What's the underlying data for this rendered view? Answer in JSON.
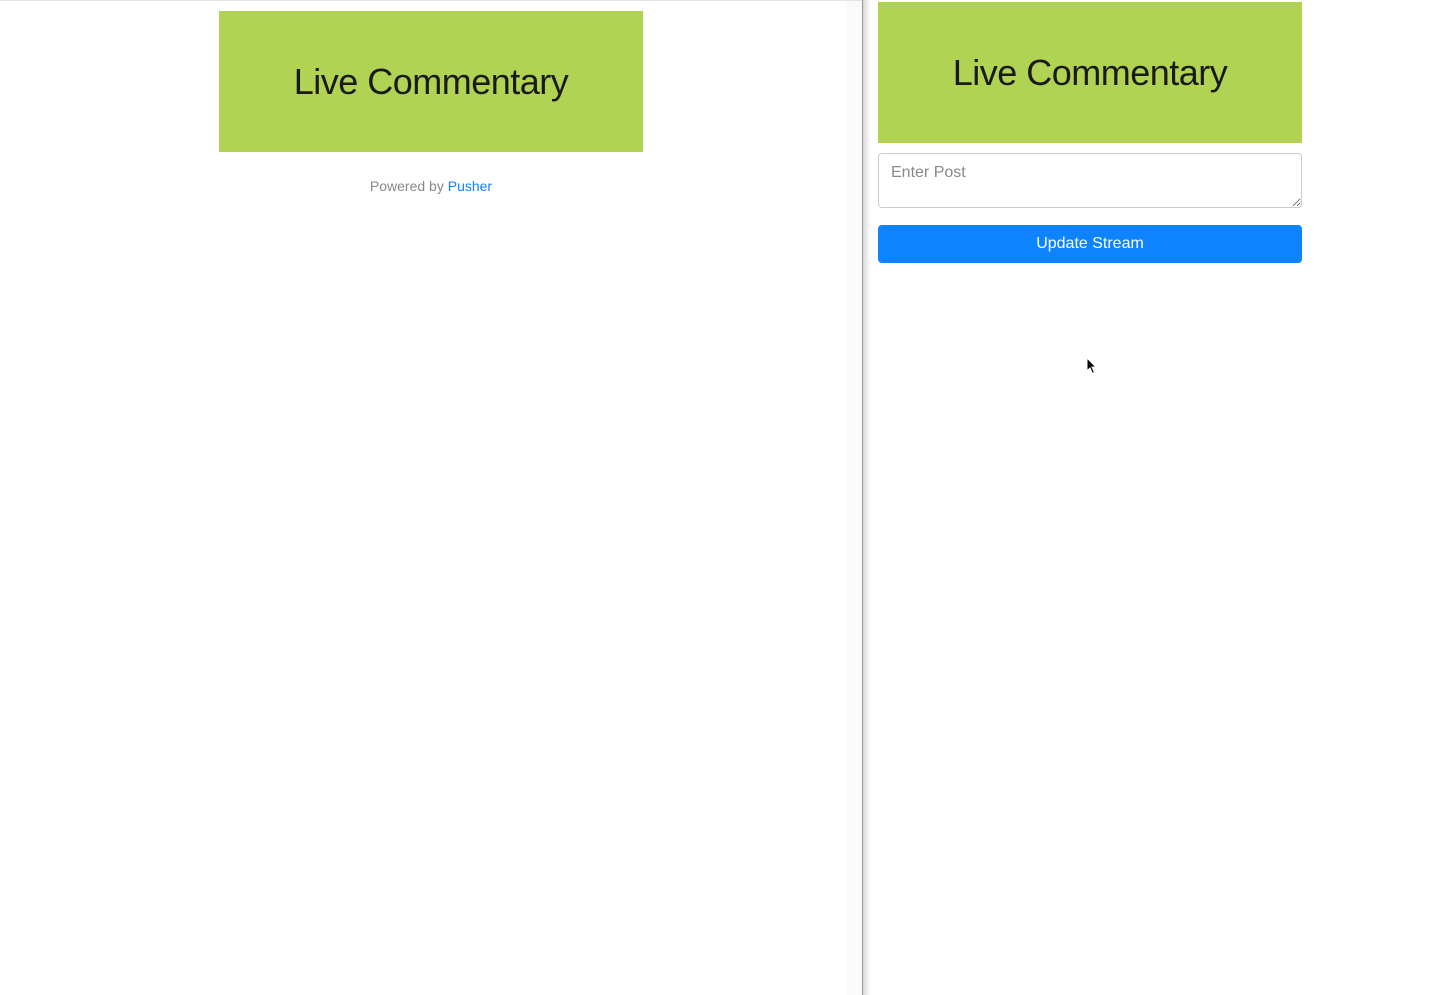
{
  "left": {
    "banner_title": "Live Commentary",
    "powered_by_prefix": "Powered by ",
    "powered_by_link": "Pusher"
  },
  "right": {
    "banner_title": "Live Commentary",
    "post_placeholder": "Enter Post",
    "update_button_label": "Update Stream"
  },
  "colors": {
    "banner_bg": "#b1d354",
    "button_bg": "#0d83fd",
    "link": "#0d83fd"
  }
}
